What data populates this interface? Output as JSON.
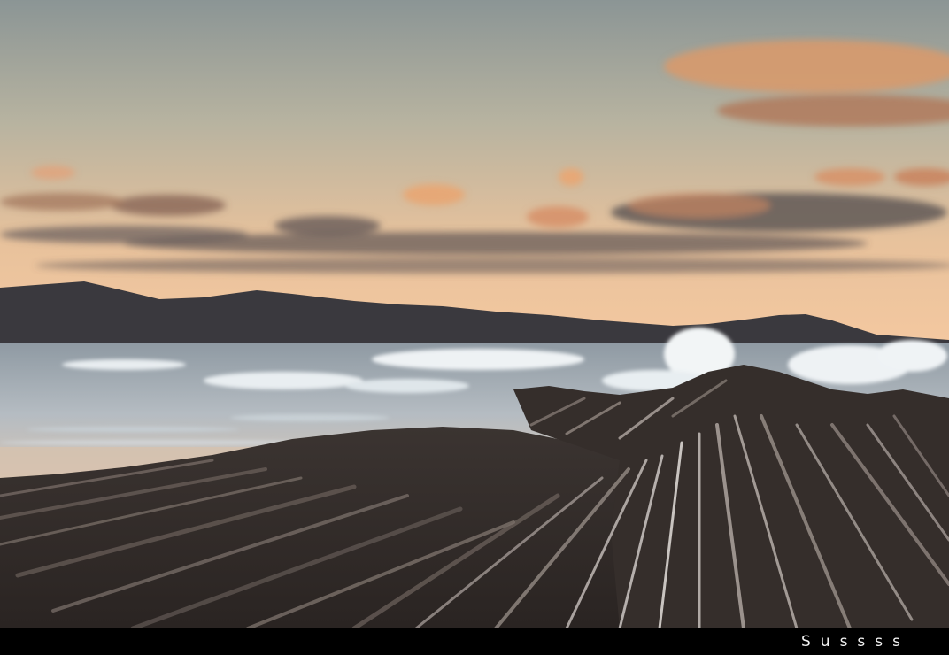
{
  "photo": {
    "subject": "sunset-seascape-flysch-rocks",
    "palette": {
      "sky_top": "#8e9797",
      "sky_mid": "#c7b59a",
      "horizon_glow": "#f3c79a",
      "cloud_light": "#e6a877",
      "cloud_dark": "#5b5253",
      "mountains": "#3a3a3e",
      "sea": "#a8b2b8",
      "surf": "#e9eef0",
      "rocks_dark": "#2f2a28",
      "rocks_light": "#9a8d86"
    }
  },
  "caption": {
    "signature": "Sussss"
  }
}
